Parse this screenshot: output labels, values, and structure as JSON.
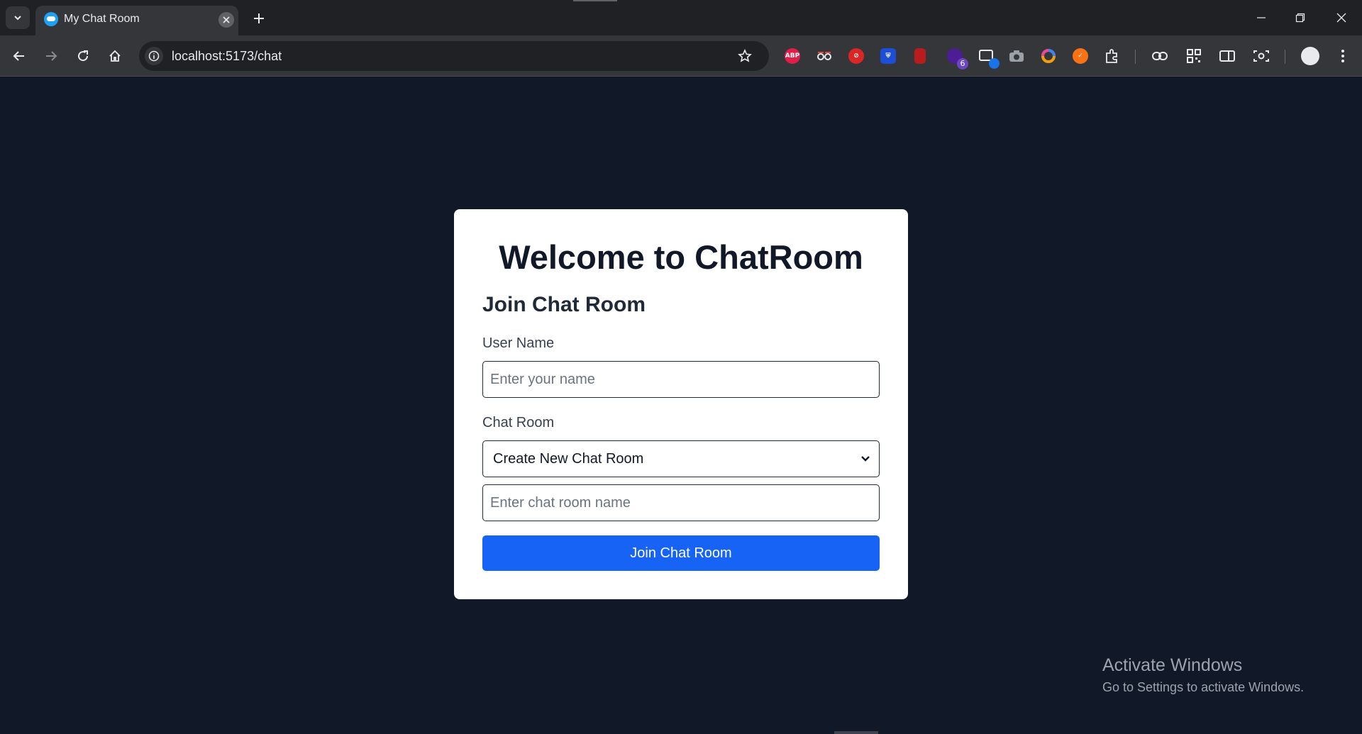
{
  "browser": {
    "tab_title": "My Chat Room",
    "url": "localhost:5173/chat",
    "extensions": [
      {
        "name": "adblock-plus-icon",
        "label": "ABP",
        "color": "#e11d48"
      },
      {
        "name": "glasses-extension-icon",
        "label": "",
        "color": "#35363a"
      },
      {
        "name": "red-extension-icon",
        "label": "",
        "color": "#dc2626"
      },
      {
        "name": "shield-extension-icon",
        "label": "",
        "color": "#1d4ed8"
      },
      {
        "name": "bookmark-extension-icon",
        "label": "",
        "color": "#b91c1c"
      },
      {
        "name": "purple-extension-icon",
        "label": "",
        "color": "#6d28d9",
        "badge": "6"
      },
      {
        "name": "window-extension-icon",
        "label": "",
        "color": "#35363a"
      },
      {
        "name": "camera-extension-icon",
        "label": "",
        "color": "#35363a"
      },
      {
        "name": "color-ring-extension-icon",
        "label": "",
        "color": "#35363a"
      },
      {
        "name": "orange-extension-icon",
        "label": "",
        "color": "#f97316"
      },
      {
        "name": "puzzle-extensions-icon",
        "label": "",
        "color": "#35363a"
      }
    ]
  },
  "card": {
    "title": "Welcome to ChatRoom",
    "subtitle": "Join Chat Room",
    "username_label": "User Name",
    "username_placeholder": "Enter your name",
    "username_value": "",
    "chatroom_label": "Chat Room",
    "chatroom_selected": "Create New Chat Room",
    "chatroom_name_placeholder": "Enter chat room name",
    "chatroom_name_value": "",
    "join_button": "Join Chat Room"
  },
  "watermark": {
    "title": "Activate Windows",
    "subtitle": "Go to Settings to activate Windows."
  },
  "colors": {
    "page_bg": "#111827",
    "card_bg": "#ffffff",
    "primary": "#1763f5"
  }
}
